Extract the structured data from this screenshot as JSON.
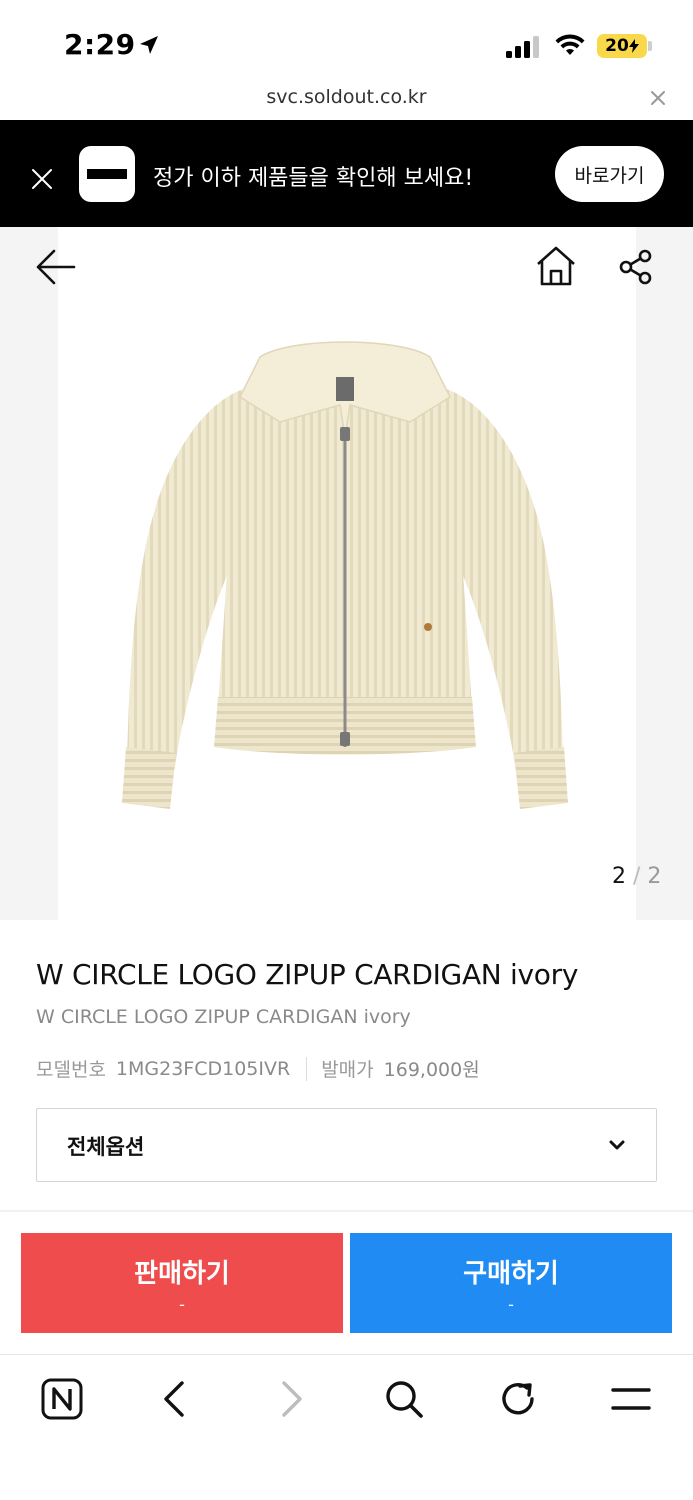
{
  "status_bar": {
    "time": "2:29",
    "battery": "20"
  },
  "browser": {
    "url": "svc.soldout.co.kr"
  },
  "promo_banner": {
    "message": "정가 이하 제품들을 확인해 보세요!",
    "button_label": "바로가기"
  },
  "gallery": {
    "current_page": "2",
    "separator": "/",
    "total_pages": "2",
    "image_alt": "W CIRCLE LOGO ZIPUP CARDIGAN ivory"
  },
  "product": {
    "title": "W CIRCLE LOGO ZIPUP CARDIGAN ivory",
    "subtitle": "W CIRCLE LOGO ZIPUP CARDIGAN ivory",
    "model_label": "모델번호",
    "model_value": "1MG23FCD105IVR",
    "release_price_label": "발매가",
    "release_price_value": "169,000원"
  },
  "option_select": {
    "label": "전체옵션"
  },
  "actions": {
    "sell_label": "판매하기",
    "sell_price": "-",
    "buy_label": "구매하기",
    "buy_price": "-"
  },
  "colors": {
    "sell": "#ef4d4d",
    "buy": "#1f8bf3",
    "banner": "#000000",
    "battery": "#f9d949"
  },
  "icons": [
    "location-arrow-icon",
    "signal-icon",
    "wifi-icon",
    "battery-icon",
    "close-icon",
    "back-arrow-icon",
    "home-icon",
    "share-icon",
    "chevron-down-icon",
    "naver-n-icon",
    "browser-back-icon",
    "browser-forward-icon",
    "search-icon",
    "reload-icon",
    "menu-icon"
  ]
}
